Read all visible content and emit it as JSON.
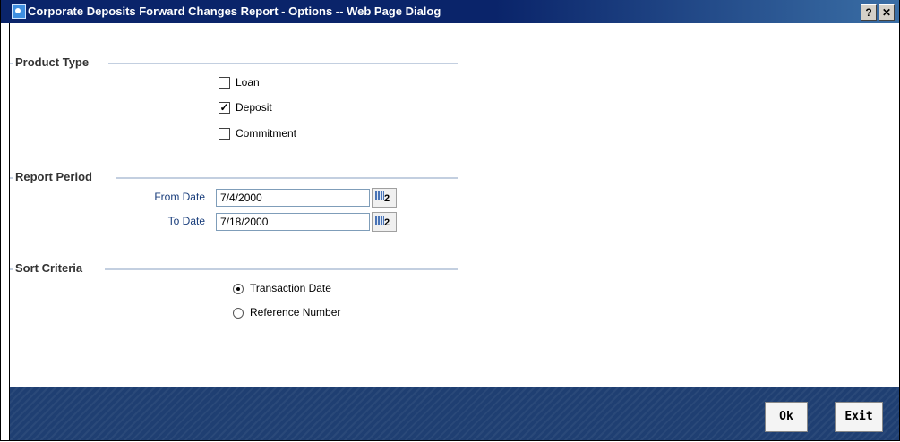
{
  "window": {
    "title": "Corporate Deposits Forward Changes Report - Options -- Web Page Dialog",
    "help_label": "?",
    "close_label": "✕"
  },
  "product_type": {
    "heading": "Product Type",
    "options": [
      {
        "label": "Loan",
        "checked": false
      },
      {
        "label": "Deposit",
        "checked": true
      },
      {
        "label": "Commitment",
        "checked": false
      }
    ]
  },
  "report_period": {
    "heading": "Report Period",
    "from_label": "From Date",
    "from_value": "7/4/2000",
    "to_label": "To Date",
    "to_value": "7/18/2000",
    "calendar_num": "2"
  },
  "sort_criteria": {
    "heading": "Sort Criteria",
    "options": [
      {
        "label": "Transaction Date",
        "selected": true
      },
      {
        "label": "Reference Number",
        "selected": false
      }
    ]
  },
  "footer": {
    "ok_label": "Ok",
    "exit_label": "Exit"
  },
  "colors": {
    "titlebar": "#0a246a",
    "footer": "#1f3f72",
    "section_rule": "#c3cfe0",
    "field_label": "#1a3e7c"
  }
}
